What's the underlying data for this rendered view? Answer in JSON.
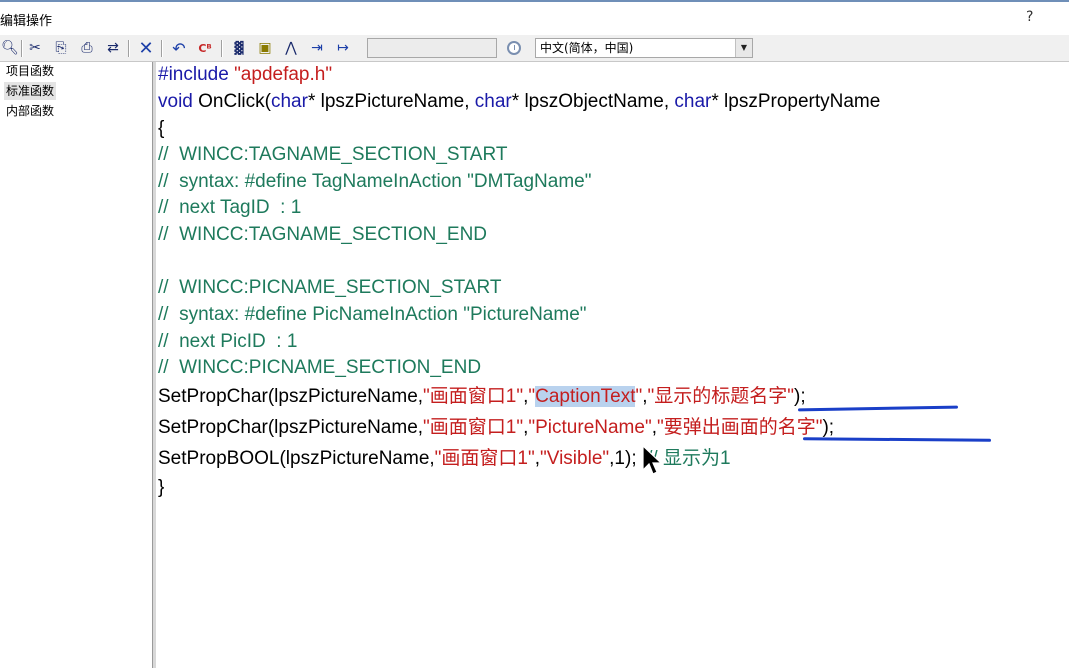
{
  "window": {
    "title": "编辑操作",
    "help": "?"
  },
  "toolbar": {
    "icons": [
      "find-icon",
      "cut-icon",
      "copy-icon",
      "paste-icon",
      "replace-icon",
      "delete-icon",
      "undo-icon",
      "compile-icon",
      "ruler-icon",
      "cube-icon",
      "pin-icon",
      "import-icon",
      "export-icon",
      "clock-icon"
    ],
    "language": "中文(简体，中国)"
  },
  "tree": {
    "items": [
      "项目函数",
      "标准函数",
      "内部函数"
    ]
  },
  "code": {
    "l1a": "#include ",
    "l1b": "\"apdefap.h\"",
    "l2a": "void ",
    "l2b": "OnClick(",
    "l2c": "char",
    "l2d": "* lpszPictureName, ",
    "l2e": "char",
    "l2f": "* lpszObjectName, ",
    "l2g": "char",
    "l2h": "* lpszPropertyName",
    "l3": "{",
    "l4": "//  WINCC:TAGNAME_SECTION_START",
    "l5": "//  syntax: #define TagNameInAction \"DMTagName\"",
    "l6": "//  next TagID  : 1",
    "l7": "//  WINCC:TAGNAME_SECTION_END",
    "l9": "//  WINCC:PICNAME_SECTION_START",
    "l10": "//  syntax: #define PicNameInAction \"PictureName\"",
    "l11": "//  next PicID  : 1",
    "l12": "//  WINCC:PICNAME_SECTION_END",
    "l13a": "SetPropChar(lpszPictureName,",
    "l13b": "\"画面窗口1\"",
    "l13c": ",",
    "l13d": "\"",
    "l13e": "CaptionText",
    "l13f": "\"",
    "l13g": ",",
    "l13h": "\"显示的标题名字\"",
    "l13i": ");",
    "l14a": "SetPropChar(lpszPictureName,",
    "l14b": "\"画面窗口1\"",
    "l14c": ",",
    "l14d": "\"PictureName\"",
    "l14e": ",",
    "l14f": "\"要弹出画面的名字\"",
    "l14g": ");",
    "l15a": "SetPropBOOL(lpszPictureName,",
    "l15b": "\"画面窗口1\"",
    "l15c": ",",
    "l15d": "\"Visible\"",
    "l15e": ",1);  ",
    "l15f": "// 显示为1",
    "l16": "}"
  },
  "colors": {
    "keyword": "#1a1aa8",
    "string": "#c41e1e",
    "comment": "#1e7a5c",
    "selection": "#b9d2ee",
    "annotation_underline": "#1a3fc8"
  }
}
